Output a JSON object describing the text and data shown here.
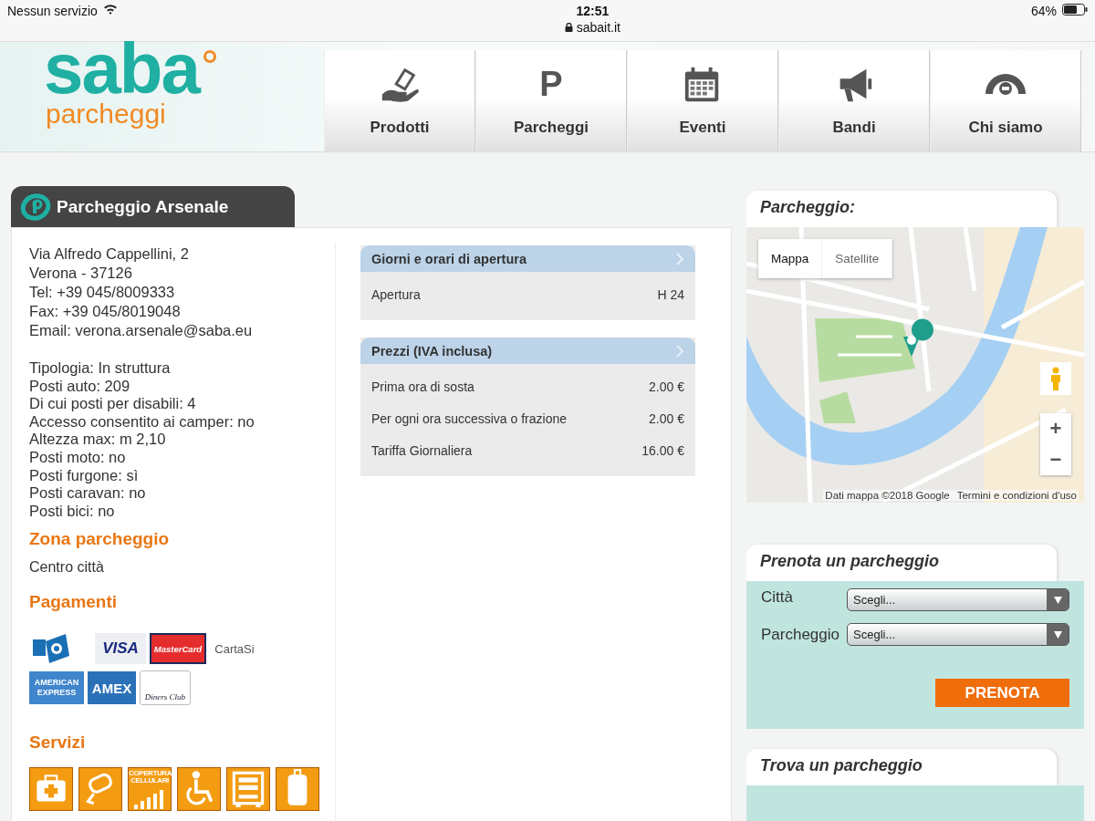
{
  "status_bar": {
    "carrier": "Nessun servizio",
    "time": "12:51",
    "url": "sabait.it",
    "battery": "64%"
  },
  "logo": {
    "name": "saba",
    "tagline": "parcheggi"
  },
  "nav": [
    {
      "label": "Prodotti",
      "kind": "hand"
    },
    {
      "label": "Parcheggi",
      "kind": "parking",
      "symbol": "P"
    },
    {
      "label": "Eventi",
      "kind": "calendar"
    },
    {
      "label": "Bandi",
      "kind": "megaphone"
    },
    {
      "label": "Chi siamo",
      "kind": "tunnel"
    }
  ],
  "parking": {
    "title": "Parcheggio Arsenale",
    "address": [
      "Via Alfredo Cappellini, 2",
      "Verona - 37126",
      "Tel: +39 045/8009333",
      "Fax: +39 045/8019048",
      "Email: verona.arsenale@saba.eu"
    ],
    "details": [
      "Tipologia: In struttura",
      "Posti auto: 209",
      "Di cui posti per disabili: 4",
      "Accesso consentito ai camper: no",
      "Altezza max: m 2,10",
      "Posti moto: no",
      "Posti furgone: sì",
      "Posti caravan: no",
      "Posti bici: no"
    ],
    "zone_heading": "Zona parcheggio",
    "zone": "Centro città",
    "payments_heading": "Pagamenti",
    "payments": [
      {
        "kind": "hand-card"
      },
      {
        "kind": "visa",
        "label": "VISA"
      },
      {
        "kind": "mastercard",
        "label": "MasterCard"
      },
      {
        "kind": "cartasi",
        "label": "CartaSi"
      },
      {
        "kind": "amex-full",
        "label": "AMERICAN EXPRESS"
      },
      {
        "kind": "amex",
        "label": "AMEX"
      },
      {
        "kind": "diners",
        "label": "Diners Club"
      }
    ],
    "services_heading": "Servizi",
    "services": [
      {
        "kind": "first-aid"
      },
      {
        "kind": "camera"
      },
      {
        "kind": "coverage",
        "label": "COPERTURA CELLULARI"
      },
      {
        "kind": "wheelchair"
      },
      {
        "kind": "vending"
      },
      {
        "kind": "luggage"
      }
    ],
    "panels": [
      {
        "title": "Giorni e orari di apertura",
        "rows": [
          {
            "label": "Apertura",
            "value": "H 24"
          }
        ]
      },
      {
        "title": "Prezzi (IVA inclusa)",
        "rows": [
          {
            "label": "Prima ora di sosta",
            "value": "2.00 €"
          },
          {
            "label": "Per ogni ora successiva o frazione",
            "value": "2.00 €"
          },
          {
            "label": "Tariffa Giornaliera",
            "value": "16.00 €"
          }
        ]
      }
    ]
  },
  "map": {
    "title": "Parcheggio:",
    "map_types": [
      {
        "label": "Mappa",
        "selected": true
      },
      {
        "label": "Satellite",
        "selected": false
      }
    ],
    "zoom_in": "+",
    "zoom_out": "−",
    "attribution": "Dati mappa ©2018 Google",
    "terms": "Termini e condizioni d'uso"
  },
  "booking": {
    "title": "Prenota un parcheggio",
    "fields": [
      {
        "label": "Città",
        "value": "Scegli..."
      },
      {
        "label": "Parcheggio",
        "value": "Scegli..."
      }
    ],
    "button": "PRENOTA"
  },
  "finder": {
    "title": "Trova un parcheggio"
  }
}
